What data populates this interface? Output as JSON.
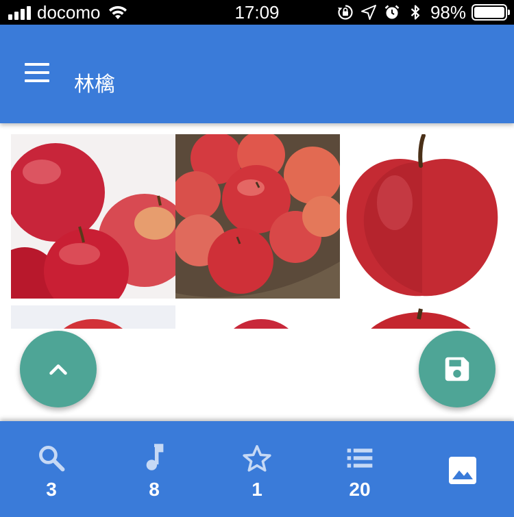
{
  "status_bar": {
    "carrier": "docomo",
    "time": "17:09",
    "battery": "98%"
  },
  "app_bar": {
    "title": "林檎",
    "menu_icon": "hamburger-menu-icon"
  },
  "image_grid": {
    "tiles": [
      {
        "subject": "apple-pile-photo"
      },
      {
        "subject": "apple-basket-photo"
      },
      {
        "subject": "single-apple-photo"
      },
      {
        "subject": "apple-photo"
      },
      {
        "subject": "apple-photo"
      },
      {
        "subject": "apple-photo"
      }
    ]
  },
  "fabs": {
    "scroll_up_icon": "chevron-up-icon",
    "save_icon": "save-icon"
  },
  "bottom_nav": {
    "items": [
      {
        "icon": "search-icon",
        "count": "3"
      },
      {
        "icon": "music-note-icon",
        "count": "8"
      },
      {
        "icon": "star-icon",
        "count": "1"
      },
      {
        "icon": "list-icon",
        "count": "20"
      },
      {
        "icon": "image-icon",
        "count": ""
      }
    ]
  },
  "colors": {
    "primary": "#3a7bd9",
    "fab": "#4ea596",
    "status_bar": "#000000"
  }
}
